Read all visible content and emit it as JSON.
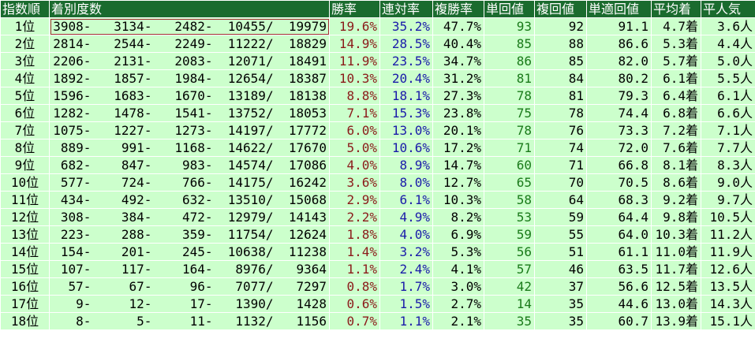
{
  "table": {
    "headers": [
      "指数順",
      "着別度数",
      "勝率",
      "連対率",
      "複勝率",
      "単回値",
      "複回値",
      "単適回値",
      "平均着",
      "平人気"
    ],
    "rows": [
      {
        "rank": "1位",
        "dist": "3908-   3134-   2482-  10455/  19979",
        "win": "19.6%",
        "ren": "35.2%",
        "fuku": "47.7%",
        "tan": "93",
        "fukuval": "92",
        "tanteki": "91.1",
        "avg": "4.7着",
        "pop": "3.6人"
      },
      {
        "rank": "2位",
        "dist": "2814-   2544-   2249-  11222/  18829",
        "win": "14.9%",
        "ren": "28.5%",
        "fuku": "40.4%",
        "tan": "85",
        "fukuval": "88",
        "tanteki": "86.6",
        "avg": "5.3着",
        "pop": "4.4人"
      },
      {
        "rank": "3位",
        "dist": "2206-   2131-   2083-  12071/  18491",
        "win": "11.9%",
        "ren": "23.5%",
        "fuku": "34.7%",
        "tan": "86",
        "fukuval": "85",
        "tanteki": "82.0",
        "avg": "5.7着",
        "pop": "5.0人"
      },
      {
        "rank": "4位",
        "dist": "1892-   1857-   1984-  12654/  18387",
        "win": "10.3%",
        "ren": "20.4%",
        "fuku": "31.2%",
        "tan": "81",
        "fukuval": "84",
        "tanteki": "80.2",
        "avg": "6.1着",
        "pop": "5.5人"
      },
      {
        "rank": "5位",
        "dist": "1596-   1683-   1670-  13189/  18138",
        "win": "8.8%",
        "ren": "18.1%",
        "fuku": "27.3%",
        "tan": "78",
        "fukuval": "81",
        "tanteki": "79.3",
        "avg": "6.4着",
        "pop": "6.1人"
      },
      {
        "rank": "6位",
        "dist": "1282-   1478-   1541-  13752/  18053",
        "win": "7.1%",
        "ren": "15.3%",
        "fuku": "23.8%",
        "tan": "75",
        "fukuval": "78",
        "tanteki": "74.4",
        "avg": "6.8着",
        "pop": "6.6人"
      },
      {
        "rank": "7位",
        "dist": "1075-   1227-   1273-  14197/  17772",
        "win": "6.0%",
        "ren": "13.0%",
        "fuku": "20.1%",
        "tan": "78",
        "fukuval": "76",
        "tanteki": "73.3",
        "avg": "7.2着",
        "pop": "7.1人"
      },
      {
        "rank": "8位",
        "dist": "889-    991-   1168-  14622/  17670",
        "win": "5.0%",
        "ren": "10.6%",
        "fuku": "17.2%",
        "tan": "71",
        "fukuval": "74",
        "tanteki": "72.0",
        "avg": "7.6着",
        "pop": "7.7人"
      },
      {
        "rank": "9位",
        "dist": "682-    847-    983-  14574/  17086",
        "win": "4.0%",
        "ren": "8.9%",
        "fuku": "14.7%",
        "tan": "60",
        "fukuval": "71",
        "tanteki": "66.8",
        "avg": "8.1着",
        "pop": "8.3人"
      },
      {
        "rank": "10位",
        "dist": "577-    724-    766-  14175/  16242",
        "win": "3.6%",
        "ren": "8.0%",
        "fuku": "12.7%",
        "tan": "65",
        "fukuval": "70",
        "tanteki": "70.5",
        "avg": "8.6着",
        "pop": "9.0人"
      },
      {
        "rank": "11位",
        "dist": "434-    492-    632-  13510/  15068",
        "win": "2.9%",
        "ren": "6.1%",
        "fuku": "10.3%",
        "tan": "58",
        "fukuval": "64",
        "tanteki": "68.3",
        "avg": "9.2着",
        "pop": "9.7人"
      },
      {
        "rank": "12位",
        "dist": "308-    384-    472-  12979/  14143",
        "win": "2.2%",
        "ren": "4.9%",
        "fuku": "8.2%",
        "tan": "53",
        "fukuval": "59",
        "tanteki": "64.4",
        "avg": "9.8着",
        "pop": "10.5人"
      },
      {
        "rank": "13位",
        "dist": "223-    288-    359-  11754/  12624",
        "win": "1.8%",
        "ren": "4.0%",
        "fuku": "6.9%",
        "tan": "59",
        "fukuval": "55",
        "tanteki": "64.0",
        "avg": "10.3着",
        "pop": "11.2人"
      },
      {
        "rank": "14位",
        "dist": "154-    201-    245-  10638/  11238",
        "win": "1.4%",
        "ren": "3.2%",
        "fuku": "5.3%",
        "tan": "56",
        "fukuval": "51",
        "tanteki": "61.1",
        "avg": "11.0着",
        "pop": "11.9人"
      },
      {
        "rank": "15位",
        "dist": "107-    117-    164-   8976/   9364",
        "win": "1.1%",
        "ren": "2.4%",
        "fuku": "4.1%",
        "tan": "57",
        "fukuval": "46",
        "tanteki": "63.5",
        "avg": "11.7着",
        "pop": "12.6人"
      },
      {
        "rank": "16位",
        "dist": "57-     67-     96-   7077/   7297",
        "win": "0.8%",
        "ren": "1.7%",
        "fuku": "3.0%",
        "tan": "42",
        "fukuval": "37",
        "tanteki": "56.6",
        "avg": "12.5着",
        "pop": "13.5人"
      },
      {
        "rank": "17位",
        "dist": "9-     12-     17-   1390/   1428",
        "win": "0.6%",
        "ren": "1.5%",
        "fuku": "2.7%",
        "tan": "14",
        "fukuval": "35",
        "tanteki": "44.6",
        "avg": "13.0着",
        "pop": "14.3人"
      },
      {
        "rank": "18位",
        "dist": "8-      5-     11-   1132/   1156",
        "win": "0.7%",
        "ren": "1.1%",
        "fuku": "2.1%",
        "tan": "35",
        "fukuval": "35",
        "tanteki": "60.7",
        "avg": "13.9着",
        "pop": "15.1人"
      }
    ]
  },
  "colors": {
    "header_bg": "#1a6b2e",
    "row_bg": "#ccffcc",
    "win_text": "#8b1a1a",
    "ren_text": "#1a1aaa",
    "tan_text": "#1a7a1a"
  }
}
